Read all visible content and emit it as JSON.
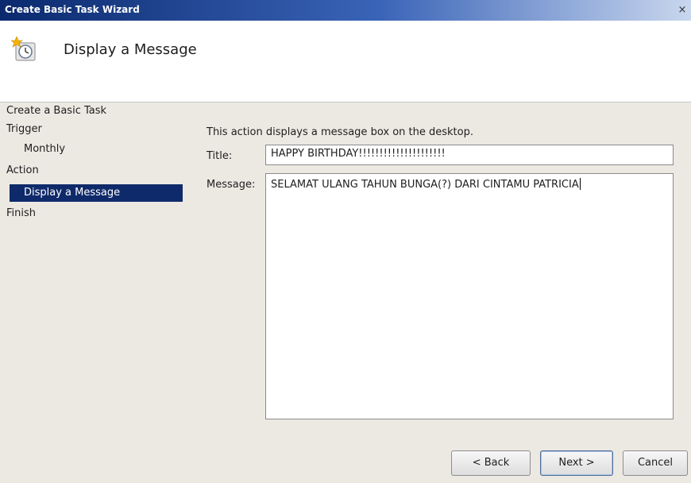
{
  "window": {
    "title": "Create Basic Task Wizard",
    "close_glyph": "×"
  },
  "header": {
    "title": "Display a Message",
    "icon": "clock-with-star-icon"
  },
  "sidebar": {
    "items": [
      {
        "label": "Create a Basic Task"
      },
      {
        "label": "Trigger"
      },
      {
        "label": "Monthly"
      },
      {
        "label": "Action"
      },
      {
        "label": "Display a Message"
      },
      {
        "label": "Finish"
      }
    ],
    "selected_color": "#0f2a6a"
  },
  "main": {
    "description": "This action displays a message box on the desktop.",
    "title_label": "Title:",
    "title_value": "HAPPY BIRTHDAY!!!!!!!!!!!!!!!!!!!!!",
    "message_label": "Message:",
    "message_value": "SELAMAT ULANG TAHUN BUNGA(?) DARI CINTAMU PATRICIA"
  },
  "footer": {
    "back_label": "< Back",
    "next_label": "Next >",
    "cancel_label": "Cancel"
  }
}
